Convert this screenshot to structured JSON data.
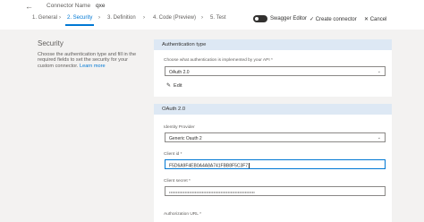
{
  "header": {
    "connector_name_label": "Connector Name",
    "connector_name_value": "qxe",
    "steps": [
      {
        "label": "1. General"
      },
      {
        "label": "2. Security"
      },
      {
        "label": "3. Definition"
      },
      {
        "label": "4. Code (Preview)"
      },
      {
        "label": "5. Test"
      }
    ],
    "active_step_index": 1,
    "swagger_editor_label": "Swagger Editor",
    "create_connector_label": "Create connector",
    "cancel_label": "Cancel"
  },
  "left_panel": {
    "title": "Security",
    "description": "Choose the authentication type and fill in the required fields to set the security for your custom connector.",
    "learn_more": "Learn more"
  },
  "auth_card": {
    "header": "Authentication type",
    "question": "Choose what authentication is implemented by your API *",
    "selected": "OAuth 2.0",
    "edit_label": "Edit"
  },
  "oauth_card": {
    "header": "OAuth 2.0",
    "identity_provider_label": "Identity Provider",
    "identity_provider_value": "Generic Oauth 2",
    "client_id_label": "Client id *",
    "client_id_value": "F5D6A9F4EB0A4A8A741FBB8F5C3F7",
    "client_secret_label": "Client secret *",
    "client_secret_value": "••••••••••••••••••••••••••••••••••••••••••••••••••••••••••••",
    "auth_url_label": "Authorization URL *"
  },
  "colors": {
    "accent": "#0078d4",
    "card_header": "#dde8f4",
    "background": "#f3f2f1"
  }
}
